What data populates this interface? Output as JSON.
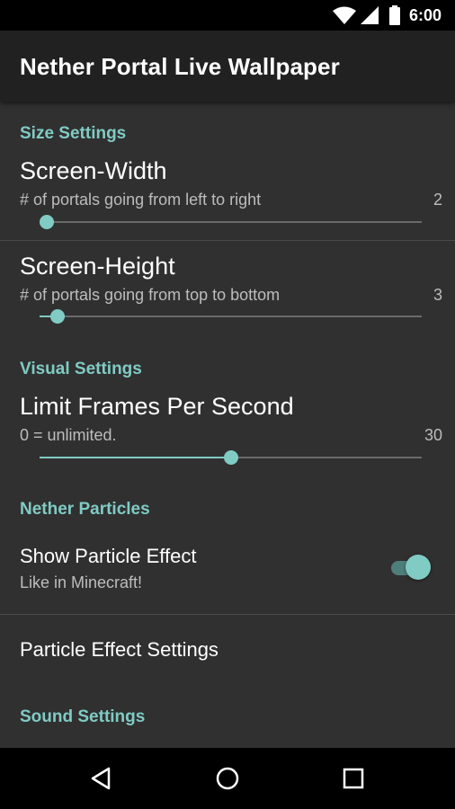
{
  "status_bar": {
    "time": "6:00",
    "icons": [
      "wifi-icon",
      "cell-signal-icon",
      "battery-icon"
    ]
  },
  "app_bar": {
    "title": "Nether Portal Live Wallpaper"
  },
  "categories": {
    "size": "Size Settings",
    "visual": "Visual Settings",
    "particles": "Nether Particles",
    "sound": "Sound Settings"
  },
  "prefs": {
    "screen_width": {
      "title": "Screen-Width",
      "summary": "# of portals going from left to right",
      "value": "2",
      "slider_fraction": 0.0
    },
    "screen_height": {
      "title": "Screen-Height",
      "summary": "# of portals going from top to bottom",
      "value": "3",
      "slider_fraction": 0.03
    },
    "fps": {
      "title": "Limit Frames Per Second",
      "summary": "0 = unlimited.",
      "value": "30",
      "slider_fraction": 0.5
    },
    "show_particles": {
      "title": "Show Particle Effect",
      "summary": "Like in Minecraft!",
      "enabled": true
    },
    "particle_settings": {
      "title": "Particle Effect Settings"
    }
  },
  "colors": {
    "accent": "#80cbc4",
    "background": "#303030",
    "app_bar": "#212121"
  },
  "nav_bar": {
    "icons": [
      "back-icon",
      "home-icon",
      "recents-icon"
    ]
  }
}
